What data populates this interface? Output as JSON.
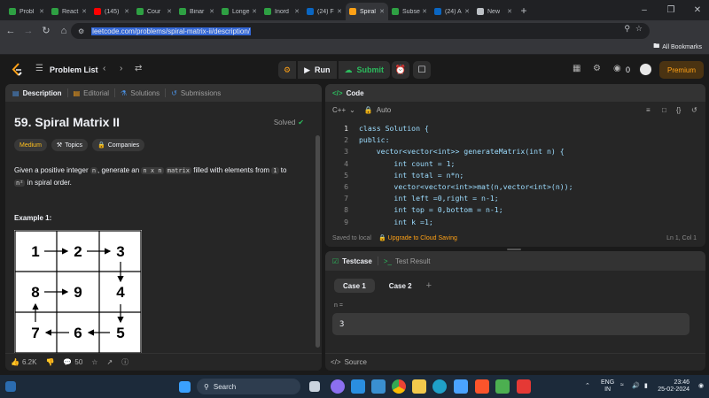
{
  "browser": {
    "tabs": [
      {
        "title": "Probl",
        "color": "#2ea043"
      },
      {
        "title": "React",
        "color": "#2ea043"
      },
      {
        "title": "(145)",
        "color": "#ff0000"
      },
      {
        "title": "Cour",
        "color": "#2ea043"
      },
      {
        "title": "Binar",
        "color": "#2ea043"
      },
      {
        "title": "Longe",
        "color": "#2ea043"
      },
      {
        "title": "Inord",
        "color": "#2ea043"
      },
      {
        "title": "(24) F",
        "color": "#0a66c2"
      },
      {
        "title": "Spiral",
        "color": "#ffa116",
        "active": true
      },
      {
        "title": "Subse",
        "color": "#2ea043"
      },
      {
        "title": "(24) A",
        "color": "#0a66c2"
      },
      {
        "title": "New",
        "color": "#bdc1c6"
      }
    ],
    "new_tab": "+",
    "url": "leetcode.com/problems/spiral-matrix-ii/description/",
    "bookmarks_label": "All Bookmarks"
  },
  "header": {
    "problem_list": "Problem List",
    "run": "Run",
    "submit": "Submit",
    "streak": "0",
    "premium": "Premium"
  },
  "description": {
    "tabs": [
      "Description",
      "Editorial",
      "Solutions",
      "Submissions"
    ],
    "title": "59. Spiral Matrix II",
    "status": "Solved",
    "difficulty": "Medium",
    "topics": "Topics",
    "companies": "Companies",
    "text_1": "Given a positive integer ",
    "code_n": "n",
    "text_2": ", generate an ",
    "code_nxn": "n x n",
    "code_matrix": "matrix",
    "text_3": " filled with elements from ",
    "code_1": "1",
    "text_4": " to ",
    "code_n2": "n²",
    "text_5": " in spiral order.",
    "example_title": "Example 1:",
    "matrix_values": [
      "1",
      "2",
      "3",
      "8",
      "9",
      "4",
      "7",
      "6",
      "5"
    ],
    "likes": "6.2K",
    "comments": "50"
  },
  "code": {
    "title": "Code",
    "language": "C++",
    "mode": "Auto",
    "lines": [
      {
        "n": "1",
        "text": "class Solution {"
      },
      {
        "n": "2",
        "text": "public:"
      },
      {
        "n": "3",
        "text": "    vector<vector<int>> generateMatrix(int n) {"
      },
      {
        "n": "4",
        "text": "        int count = 1;"
      },
      {
        "n": "5",
        "text": "        int total = n*n;"
      },
      {
        "n": "6",
        "text": "        vector<vector<int>>mat(n,vector<int>(n));"
      },
      {
        "n": "7",
        "text": "        int left =0,right = n-1;"
      },
      {
        "n": "8",
        "text": "        int top = 0,bottom = n-1;"
      },
      {
        "n": "9",
        "text": "        int k =1;"
      }
    ],
    "saved": "Saved to local",
    "upgrade": "Upgrade to Cloud Saving",
    "position": "Ln 1, Col 1"
  },
  "testcase": {
    "tab_testcase": "Testcase",
    "tab_result": "Test Result",
    "case1": "Case 1",
    "case2": "Case 2",
    "plus": "+",
    "var_label": "n =",
    "var_value": "3",
    "source": "Source"
  },
  "taskbar": {
    "search": "Search",
    "lang": "ENG",
    "region": "IN",
    "time": "23:46",
    "date": "25-02-2024"
  }
}
